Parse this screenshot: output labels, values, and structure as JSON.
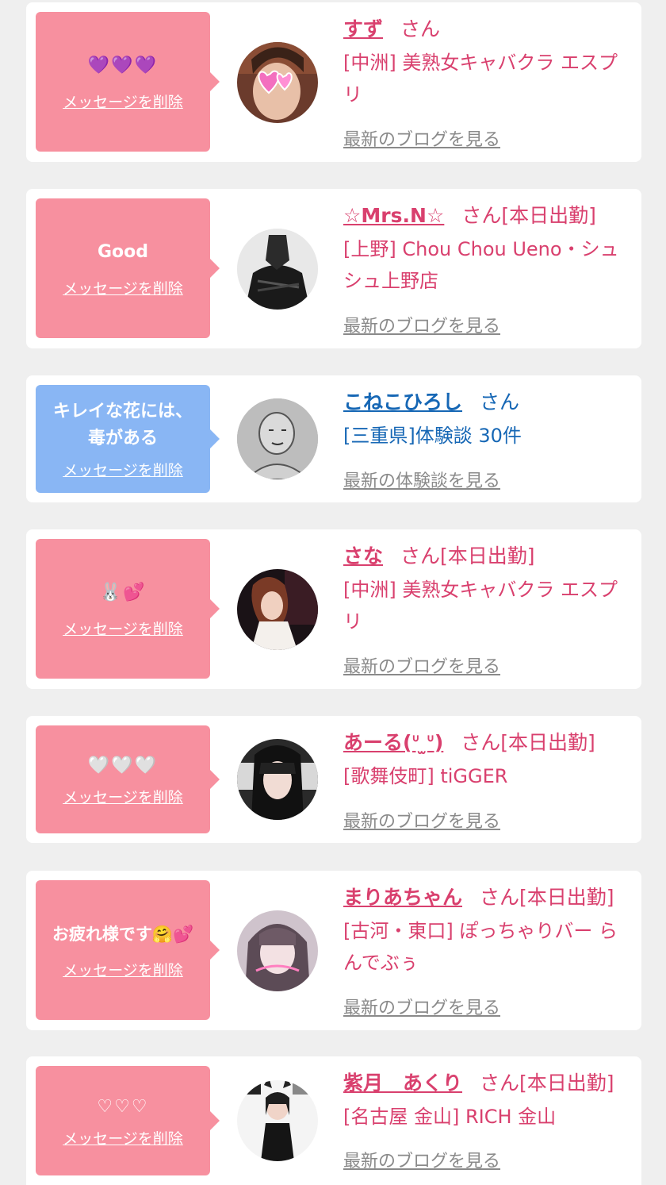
{
  "delete_label": "メッセージを削除",
  "san": "さん",
  "cards": [
    {
      "message": "💜💜💜",
      "name": "すず",
      "honorific": "さん",
      "shop": "[中洲] 美熟女キャバクラ エスプリ",
      "more": "最新のブログを見る"
    },
    {
      "message": "Good",
      "name": "☆Mrs.N☆",
      "honorific": "さん[本日出勤]",
      "shop": "[上野] Chou Chou Ueno・シュシュ上野店",
      "more": "最新のブログを見る"
    },
    {
      "message": "キレイな花には、毒がある",
      "name": "こねこひろし",
      "honorific": "さん",
      "shop": "[三重県]体験談 30件",
      "more": "最新の体験談を見る"
    },
    {
      "message": "🐰💕",
      "name": "さな",
      "honorific": "さん[本日出勤]",
      "shop": "[中洲] 美熟女キャバクラ エスプリ",
      "more": "最新のブログを見る"
    },
    {
      "message": "🤍🤍🤍",
      "name": "あーる(ᐡ ̫ᐡ)",
      "honorific": "さん[本日出勤]",
      "shop": "[歌舞伎町] tiGGER",
      "more": "最新のブログを見る"
    },
    {
      "message": "お疲れ様です🤗💕",
      "name": "まりあちゃん",
      "honorific": "さん[本日出勤]",
      "shop": "[古河・東口] ぽっちゃりバー らんでぶぅ",
      "more": "最新のブログを見る"
    },
    {
      "message": "♡♡♡",
      "name": "紫月　あくり",
      "honorific": "さん[本日出勤]",
      "shop": "[名古屋 金山] RICH 金山",
      "more": "最新のブログを見る"
    }
  ],
  "colors": {
    "bubble_pink": "#f7909f",
    "bubble_blue": "#89b6f4",
    "name_pink": "#d9406e",
    "name_blue": "#1667b5",
    "link_gray": "#8a8a8a"
  }
}
